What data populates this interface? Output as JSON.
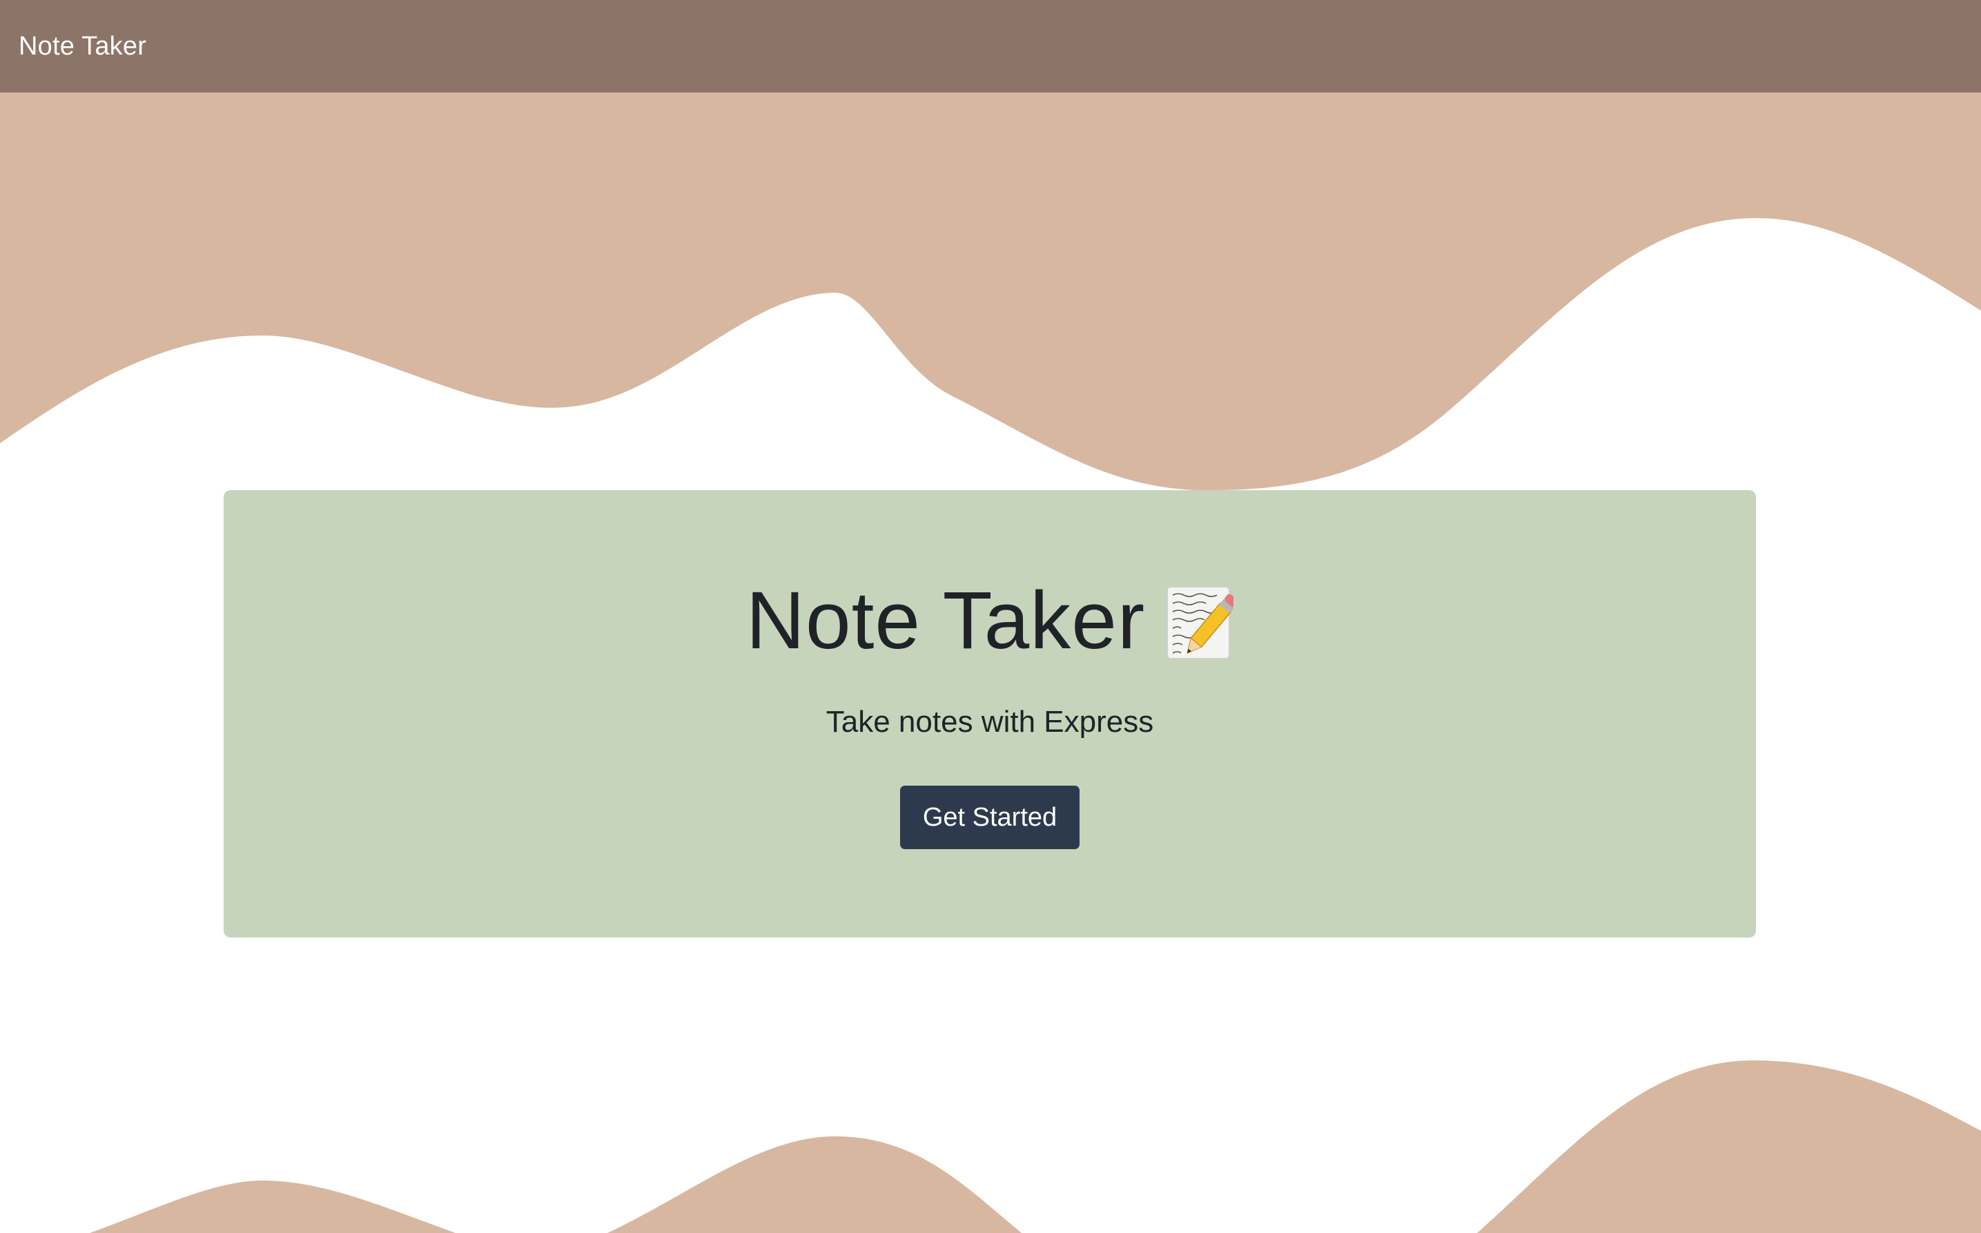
{
  "navbar": {
    "brand": "Note Taker"
  },
  "hero": {
    "title": "Note Taker",
    "title_icon": "memo-icon",
    "subtitle": "Take notes with Express",
    "cta_label": "Get Started"
  },
  "colors": {
    "navbar_bg": "#8d7468",
    "wave": "#d8b7a0",
    "card_bg": "#c6d4bc",
    "button_bg": "#2d3a4e",
    "text": "#1f2327"
  }
}
